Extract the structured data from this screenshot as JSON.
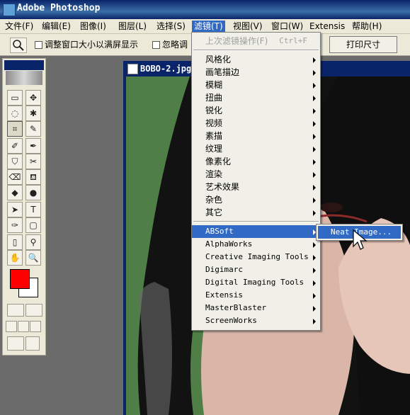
{
  "window": {
    "title": "Adobe Photoshop"
  },
  "menubar": {
    "items": [
      {
        "label": "文件(F)"
      },
      {
        "label": "编辑(E)"
      },
      {
        "label": "图像(I)"
      },
      {
        "label": "图层(L)"
      },
      {
        "label": "选择(S)"
      },
      {
        "label": "滤镜(T)"
      },
      {
        "label": "视图(V)"
      },
      {
        "label": "窗口(W)"
      },
      {
        "label": "Extensis"
      },
      {
        "label": "帮助(H)"
      }
    ]
  },
  "options_bar": {
    "resize_label": "调整窗口大小以满屏显示",
    "ignore_label": "忽略调",
    "print_size_label": "打印尺寸"
  },
  "toolbox": {
    "tools": [
      "▭",
      "✥",
      "◌",
      "✱",
      "⌗",
      "✎",
      "✐",
      "✒",
      "⛉",
      "✂",
      "⌫",
      "⛾",
      "◆",
      "●",
      "➤",
      "T",
      "✑",
      "▢",
      "▯",
      "⚲",
      "✋",
      "🔍"
    ]
  },
  "colors": {
    "foreground": "#ff0000",
    "background": "#ffffff",
    "accent": "#316ac5"
  },
  "document": {
    "title": "BOBO-2.jpg"
  },
  "filter_menu": {
    "last_filter": {
      "label": "上次滤镜操作(F)",
      "shortcut": "Ctrl+F"
    },
    "builtin": [
      "风格化",
      "画笔描边",
      "模糊",
      "扭曲",
      "锐化",
      "视频",
      "素描",
      "纹理",
      "像素化",
      "渲染",
      "艺术效果",
      "杂色",
      "其它"
    ],
    "plugins": [
      "ABSoft",
      "AlphaWorks",
      "Creative Imaging Tools",
      "Digimarc",
      "Digital Imaging Tools",
      "Extensis",
      "MasterBlaster",
      "ScreenWorks"
    ],
    "highlighted_plugin": "ABSoft"
  },
  "submenu": {
    "items": [
      "Neat Image..."
    ]
  }
}
